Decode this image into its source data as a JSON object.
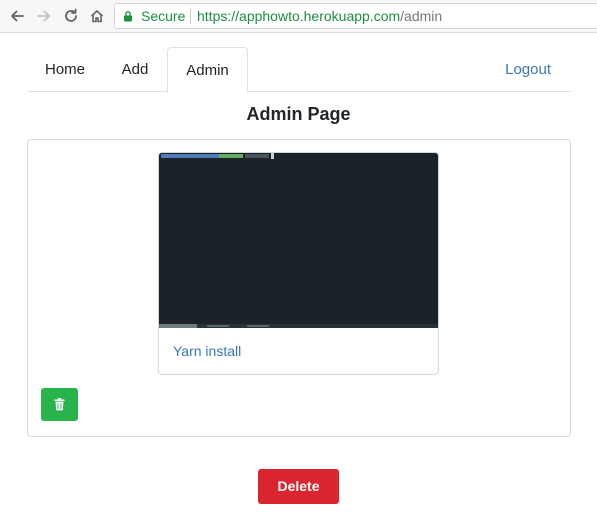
{
  "browser": {
    "secure_label": "Secure",
    "url_scheme": "https://",
    "url_host": "apphowto.herokuapp.com",
    "url_path": "/admin",
    "icons": [
      "back-arrow-icon",
      "forward-arrow-icon",
      "reload-icon",
      "home-icon",
      "lock-icon"
    ]
  },
  "nav": {
    "tabs": [
      {
        "label": "Home"
      },
      {
        "label": "Add"
      },
      {
        "label": "Admin",
        "active": true
      }
    ],
    "logout_label": "Logout"
  },
  "page": {
    "title": "Admin Page"
  },
  "card": {
    "title": "Yarn install",
    "thumbnail_background": "#1b2329"
  },
  "actions": {
    "trash_icon": "trash-icon",
    "delete_label": "Delete"
  },
  "colors": {
    "link": "#3a77b8",
    "success": "#28b44b",
    "danger": "#d9252f",
    "secure_green": "#1e8e3e"
  }
}
